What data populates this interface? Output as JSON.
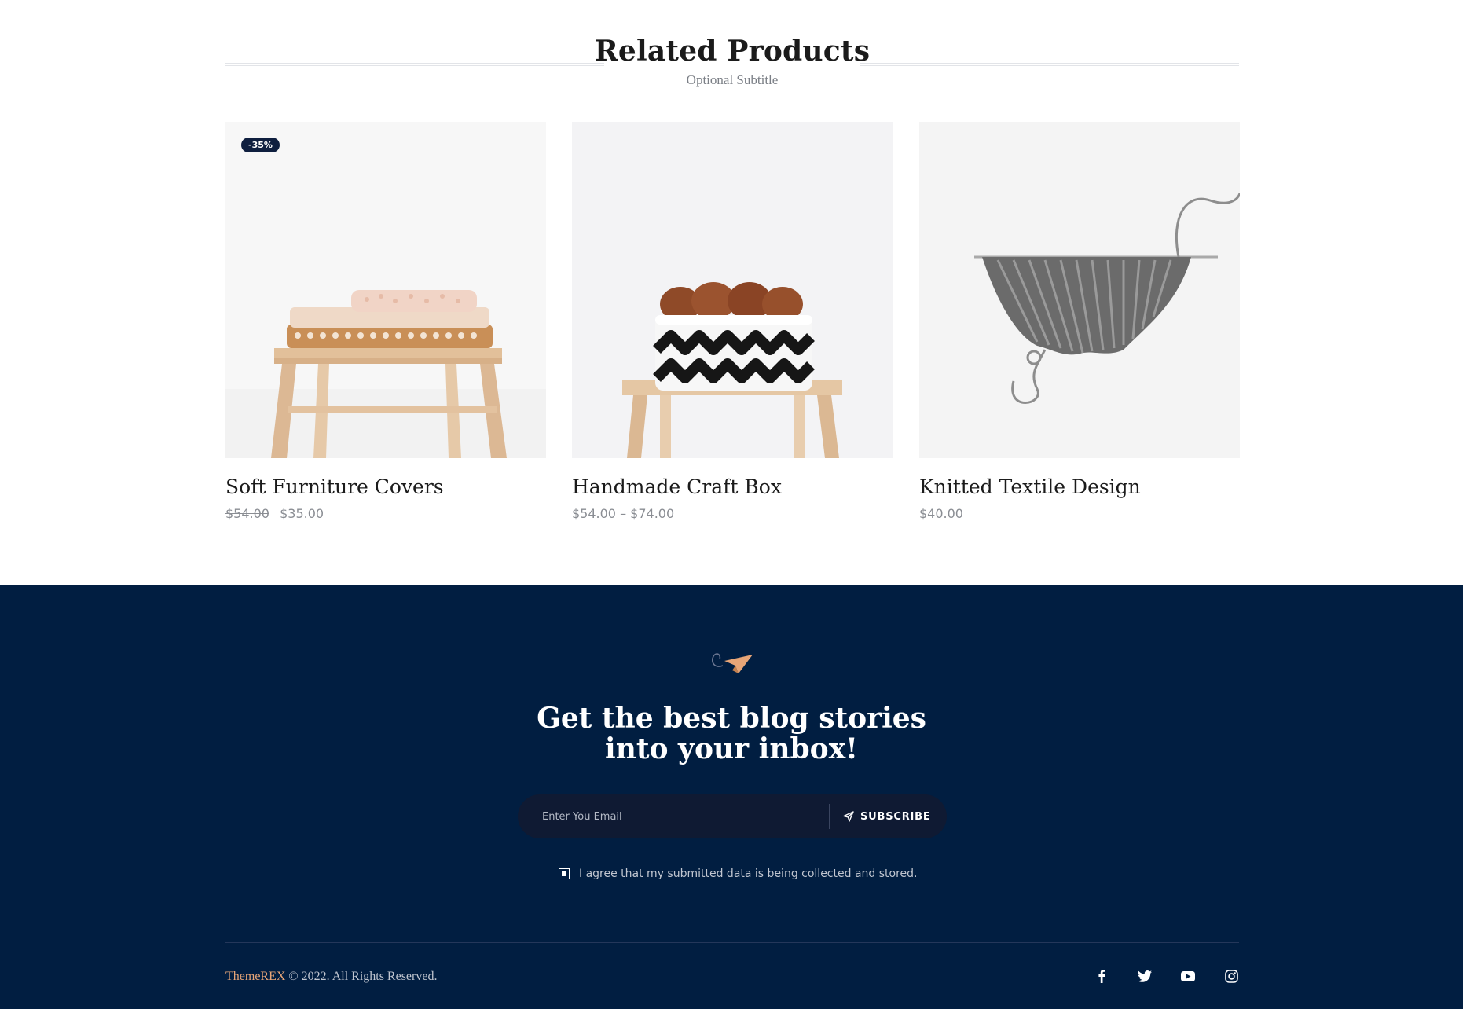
{
  "related": {
    "title": "Related Products",
    "subtitle": "Optional Subtitle",
    "products": [
      {
        "name": "Soft Furniture Covers",
        "badge": "-35%",
        "old_price": "$54.00",
        "price": "$35.00",
        "image_icon": "stool-with-folded-blankets"
      },
      {
        "name": "Handmade Craft Box",
        "price": "$54.00 – $74.00",
        "image_icon": "knit-basket-with-yarn"
      },
      {
        "name": "Knitted Textile Design",
        "price": "$40.00",
        "image_icon": "knitting-on-needle"
      }
    ]
  },
  "newsletter": {
    "icon": "paper-plane-icon",
    "title_line1": "Get the best blog stories",
    "title_line2": "into your inbox!",
    "email_placeholder": "Enter You Email",
    "subscribe_label": "SUBSCRIBE",
    "consent_text": "I agree that my submitted data is being collected and stored.",
    "consent_checked": true
  },
  "footer": {
    "brand": "ThemeREX",
    "copyright": "© 2022. All Rights Reserved.",
    "socials": [
      "facebook-icon",
      "twitter-icon",
      "youtube-icon",
      "instagram-icon"
    ]
  },
  "colors": {
    "navy": "#011e41",
    "accent": "#e7a577",
    "price_gray": "#8a8d93",
    "badge_bg": "#0f1f3f"
  }
}
